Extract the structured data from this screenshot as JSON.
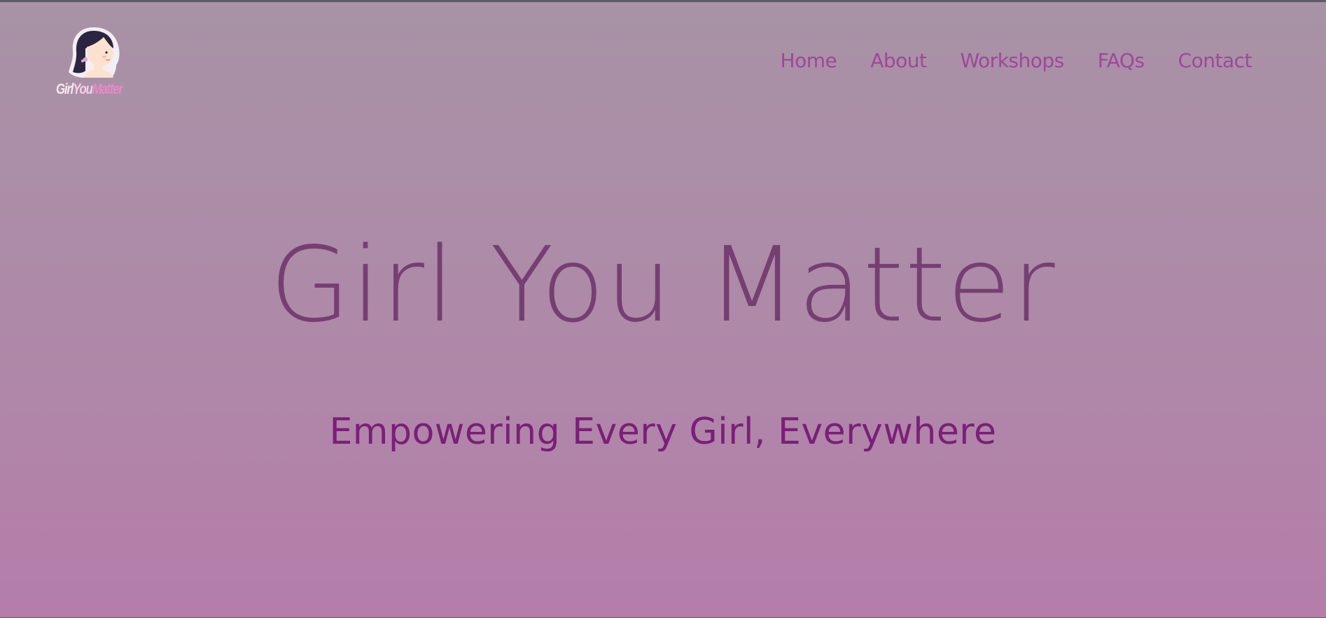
{
  "brand": {
    "logo_text_1": "Girl",
    "logo_text_2": "You",
    "logo_text_3": "Matter"
  },
  "nav": {
    "items": [
      {
        "label": "Home"
      },
      {
        "label": "About"
      },
      {
        "label": "Workshops"
      },
      {
        "label": "FAQs"
      },
      {
        "label": "Contact"
      }
    ]
  },
  "hero": {
    "title": "Girl You Matter",
    "subtitle": "Empowering Every Girl, Everywhere"
  },
  "colors": {
    "background_top": "#a892a6",
    "background_bottom": "#b57daa",
    "nav_link": "#a0469b",
    "title": "#763f72",
    "subtitle": "#7a1f78"
  }
}
